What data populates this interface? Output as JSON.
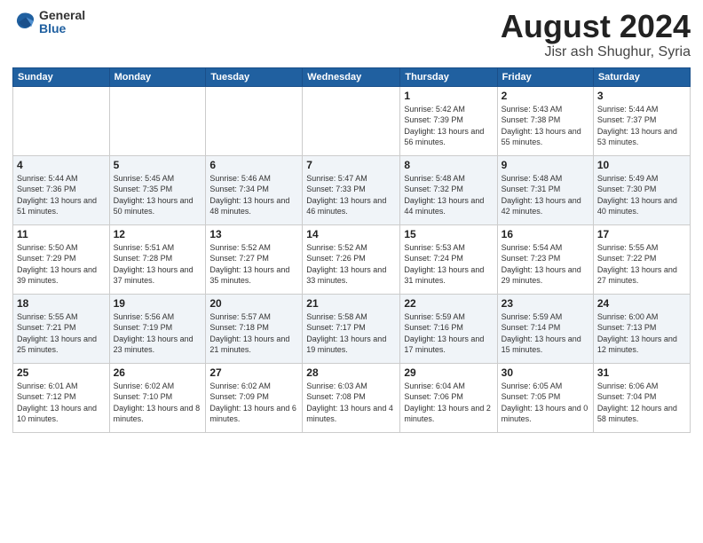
{
  "header": {
    "logo_line1": "General",
    "logo_line2": "Blue",
    "month": "August 2024",
    "location": "Jisr ash Shughur, Syria"
  },
  "weekdays": [
    "Sunday",
    "Monday",
    "Tuesday",
    "Wednesday",
    "Thursday",
    "Friday",
    "Saturday"
  ],
  "weeks": [
    [
      {
        "day": "",
        "sunrise": "",
        "sunset": "",
        "daylight": ""
      },
      {
        "day": "",
        "sunrise": "",
        "sunset": "",
        "daylight": ""
      },
      {
        "day": "",
        "sunrise": "",
        "sunset": "",
        "daylight": ""
      },
      {
        "day": "",
        "sunrise": "",
        "sunset": "",
        "daylight": ""
      },
      {
        "day": "1",
        "sunrise": "Sunrise: 5:42 AM",
        "sunset": "Sunset: 7:39 PM",
        "daylight": "Daylight: 13 hours and 56 minutes."
      },
      {
        "day": "2",
        "sunrise": "Sunrise: 5:43 AM",
        "sunset": "Sunset: 7:38 PM",
        "daylight": "Daylight: 13 hours and 55 minutes."
      },
      {
        "day": "3",
        "sunrise": "Sunrise: 5:44 AM",
        "sunset": "Sunset: 7:37 PM",
        "daylight": "Daylight: 13 hours and 53 minutes."
      }
    ],
    [
      {
        "day": "4",
        "sunrise": "Sunrise: 5:44 AM",
        "sunset": "Sunset: 7:36 PM",
        "daylight": "Daylight: 13 hours and 51 minutes."
      },
      {
        "day": "5",
        "sunrise": "Sunrise: 5:45 AM",
        "sunset": "Sunset: 7:35 PM",
        "daylight": "Daylight: 13 hours and 50 minutes."
      },
      {
        "day": "6",
        "sunrise": "Sunrise: 5:46 AM",
        "sunset": "Sunset: 7:34 PM",
        "daylight": "Daylight: 13 hours and 48 minutes."
      },
      {
        "day": "7",
        "sunrise": "Sunrise: 5:47 AM",
        "sunset": "Sunset: 7:33 PM",
        "daylight": "Daylight: 13 hours and 46 minutes."
      },
      {
        "day": "8",
        "sunrise": "Sunrise: 5:48 AM",
        "sunset": "Sunset: 7:32 PM",
        "daylight": "Daylight: 13 hours and 44 minutes."
      },
      {
        "day": "9",
        "sunrise": "Sunrise: 5:48 AM",
        "sunset": "Sunset: 7:31 PM",
        "daylight": "Daylight: 13 hours and 42 minutes."
      },
      {
        "day": "10",
        "sunrise": "Sunrise: 5:49 AM",
        "sunset": "Sunset: 7:30 PM",
        "daylight": "Daylight: 13 hours and 40 minutes."
      }
    ],
    [
      {
        "day": "11",
        "sunrise": "Sunrise: 5:50 AM",
        "sunset": "Sunset: 7:29 PM",
        "daylight": "Daylight: 13 hours and 39 minutes."
      },
      {
        "day": "12",
        "sunrise": "Sunrise: 5:51 AM",
        "sunset": "Sunset: 7:28 PM",
        "daylight": "Daylight: 13 hours and 37 minutes."
      },
      {
        "day": "13",
        "sunrise": "Sunrise: 5:52 AM",
        "sunset": "Sunset: 7:27 PM",
        "daylight": "Daylight: 13 hours and 35 minutes."
      },
      {
        "day": "14",
        "sunrise": "Sunrise: 5:52 AM",
        "sunset": "Sunset: 7:26 PM",
        "daylight": "Daylight: 13 hours and 33 minutes."
      },
      {
        "day": "15",
        "sunrise": "Sunrise: 5:53 AM",
        "sunset": "Sunset: 7:24 PM",
        "daylight": "Daylight: 13 hours and 31 minutes."
      },
      {
        "day": "16",
        "sunrise": "Sunrise: 5:54 AM",
        "sunset": "Sunset: 7:23 PM",
        "daylight": "Daylight: 13 hours and 29 minutes."
      },
      {
        "day": "17",
        "sunrise": "Sunrise: 5:55 AM",
        "sunset": "Sunset: 7:22 PM",
        "daylight": "Daylight: 13 hours and 27 minutes."
      }
    ],
    [
      {
        "day": "18",
        "sunrise": "Sunrise: 5:55 AM",
        "sunset": "Sunset: 7:21 PM",
        "daylight": "Daylight: 13 hours and 25 minutes."
      },
      {
        "day": "19",
        "sunrise": "Sunrise: 5:56 AM",
        "sunset": "Sunset: 7:19 PM",
        "daylight": "Daylight: 13 hours and 23 minutes."
      },
      {
        "day": "20",
        "sunrise": "Sunrise: 5:57 AM",
        "sunset": "Sunset: 7:18 PM",
        "daylight": "Daylight: 13 hours and 21 minutes."
      },
      {
        "day": "21",
        "sunrise": "Sunrise: 5:58 AM",
        "sunset": "Sunset: 7:17 PM",
        "daylight": "Daylight: 13 hours and 19 minutes."
      },
      {
        "day": "22",
        "sunrise": "Sunrise: 5:59 AM",
        "sunset": "Sunset: 7:16 PM",
        "daylight": "Daylight: 13 hours and 17 minutes."
      },
      {
        "day": "23",
        "sunrise": "Sunrise: 5:59 AM",
        "sunset": "Sunset: 7:14 PM",
        "daylight": "Daylight: 13 hours and 15 minutes."
      },
      {
        "day": "24",
        "sunrise": "Sunrise: 6:00 AM",
        "sunset": "Sunset: 7:13 PM",
        "daylight": "Daylight: 13 hours and 12 minutes."
      }
    ],
    [
      {
        "day": "25",
        "sunrise": "Sunrise: 6:01 AM",
        "sunset": "Sunset: 7:12 PM",
        "daylight": "Daylight: 13 hours and 10 minutes."
      },
      {
        "day": "26",
        "sunrise": "Sunrise: 6:02 AM",
        "sunset": "Sunset: 7:10 PM",
        "daylight": "Daylight: 13 hours and 8 minutes."
      },
      {
        "day": "27",
        "sunrise": "Sunrise: 6:02 AM",
        "sunset": "Sunset: 7:09 PM",
        "daylight": "Daylight: 13 hours and 6 minutes."
      },
      {
        "day": "28",
        "sunrise": "Sunrise: 6:03 AM",
        "sunset": "Sunset: 7:08 PM",
        "daylight": "Daylight: 13 hours and 4 minutes."
      },
      {
        "day": "29",
        "sunrise": "Sunrise: 6:04 AM",
        "sunset": "Sunset: 7:06 PM",
        "daylight": "Daylight: 13 hours and 2 minutes."
      },
      {
        "day": "30",
        "sunrise": "Sunrise: 6:05 AM",
        "sunset": "Sunset: 7:05 PM",
        "daylight": "Daylight: 13 hours and 0 minutes."
      },
      {
        "day": "31",
        "sunrise": "Sunrise: 6:06 AM",
        "sunset": "Sunset: 7:04 PM",
        "daylight": "Daylight: 12 hours and 58 minutes."
      }
    ]
  ]
}
